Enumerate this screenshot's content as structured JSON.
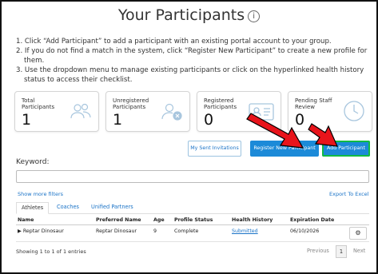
{
  "header": {
    "title": "Your Participants",
    "info_icon": "info-icon"
  },
  "instructions": [
    "1. Click “Add Participant” to add a participant with an existing portal account to your group.",
    "2. If you do not find a match in the system, click “Register New Participant” to create a new profile for them.",
    "3. Use the dropdown menu to manage existing participants or click on the hyperlinked health history status to access their checklist."
  ],
  "cards": [
    {
      "label": "Total Participants",
      "value": "1",
      "icon": "users-icon"
    },
    {
      "label": "Unregistered Participants",
      "value": "1",
      "icon": "user-remove-icon"
    },
    {
      "label": "Registered Participants",
      "value": "0",
      "icon": "id-card-icon"
    },
    {
      "label": "Pending Staff Review",
      "value": "0",
      "icon": "clock-icon"
    }
  ],
  "actions": {
    "sent_invitations": "My Sent Invitations",
    "register_new": "Register New Participant",
    "add_participant": "Add Participant"
  },
  "keyword": {
    "label": "Keyword:",
    "value": "",
    "placeholder": ""
  },
  "links": {
    "show_more_filters": "Show more filters",
    "export": "Export To Excel"
  },
  "tabs": [
    "Athletes",
    "Coaches",
    "Unified Partners"
  ],
  "table": {
    "columns": [
      "Name",
      "Preferred Name",
      "Age",
      "Profile Status",
      "Health History",
      "Expiration Date"
    ],
    "rows": [
      {
        "name": "▶ Reptar Dinosaur",
        "preferred": "Reptar Dinosaur",
        "age": "9",
        "status": "Complete",
        "health": "Submitted",
        "expiration": "06/10/2026"
      }
    ]
  },
  "footer": {
    "showing": "Showing 1 to 1 of 1 entries",
    "previous": "Previous",
    "page": "1",
    "next": "Next"
  },
  "colors": {
    "primary": "#1c8ad8",
    "link": "#1a73c7",
    "annotation_arrow": "#e8141b"
  }
}
